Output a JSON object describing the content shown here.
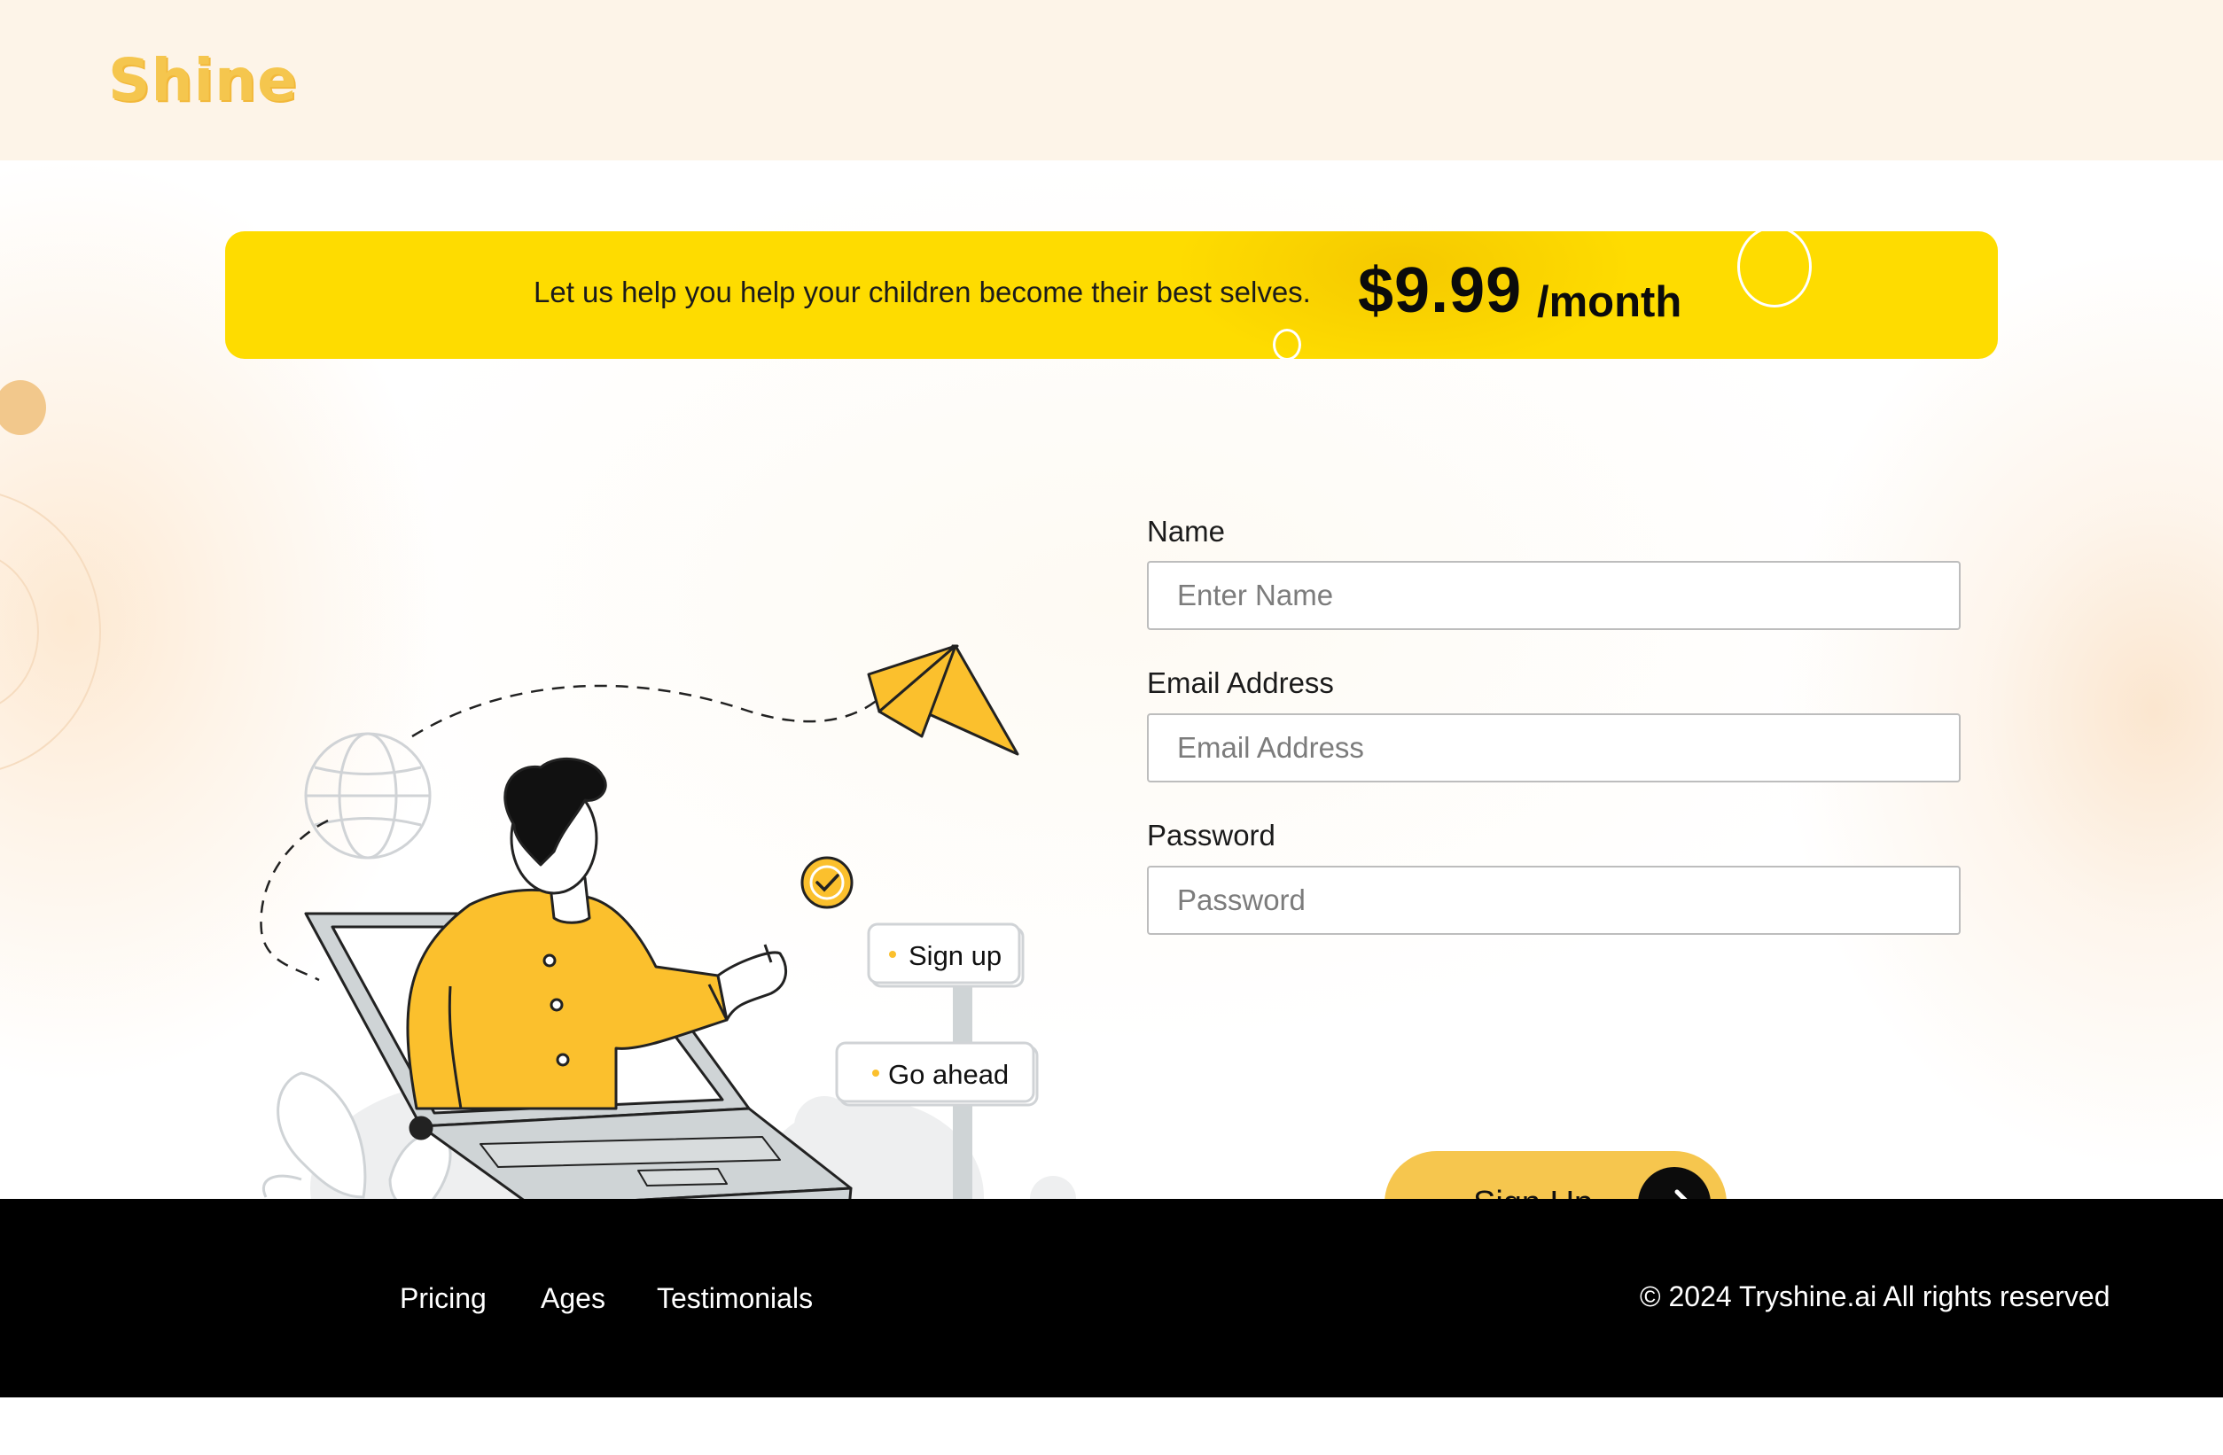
{
  "header": {
    "logo_text": "Shine"
  },
  "banner": {
    "tagline": "Let us help you help your children become their best selves.",
    "price": "$9.99",
    "period": "/month"
  },
  "illustration": {
    "bubble_signup": "Sign up",
    "bubble_goahead": "Go ahead"
  },
  "form": {
    "name_label": "Name",
    "name_placeholder": "Enter Name",
    "email_label": "Email Address",
    "email_placeholder": "Email Address",
    "password_label": "Password",
    "password_placeholder": "Password",
    "submit_label": "Sign Up"
  },
  "footer": {
    "links": [
      "Pricing",
      "Ages",
      "Testimonials"
    ],
    "copyright": "© 2024 Tryshine.ai All rights reserved"
  },
  "colors": {
    "header_bg": "#fdf4e8",
    "logo": "#f5c64e",
    "banner_bg": "#fedc00",
    "button_bg": "#f6c64e",
    "accent_yellow": "#fbc02d",
    "footer_bg": "#000000"
  },
  "icons": {
    "submit_icon": "arrow-right-icon",
    "check_icon": "check-circle-icon"
  }
}
